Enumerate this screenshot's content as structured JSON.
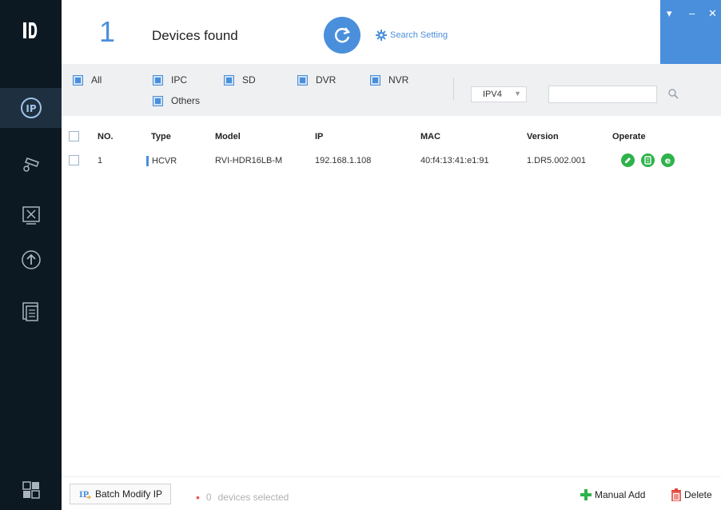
{
  "header": {
    "count": "1",
    "found_label": "Devices found",
    "search_setting": "Search Setting"
  },
  "filters": {
    "options": [
      {
        "label": "All",
        "checked": true
      },
      {
        "label": "IPC",
        "checked": true
      },
      {
        "label": "SD",
        "checked": true
      },
      {
        "label": "DVR",
        "checked": true
      },
      {
        "label": "NVR",
        "checked": true
      },
      {
        "label": "Others",
        "checked": true
      }
    ],
    "ip_version": "IPV4",
    "search_value": ""
  },
  "table": {
    "headers": {
      "no": "NO.",
      "type": "Type",
      "model": "Model",
      "ip": "IP",
      "mac": "MAC",
      "version": "Version",
      "operate": "Operate"
    },
    "rows": [
      {
        "no": "1",
        "type": "HCVR",
        "model": "RVI-HDR16LB-M",
        "ip": "192.168.1.108",
        "mac": "40:f4:13:41:e1:91",
        "version": "1.DR5.002.001"
      }
    ]
  },
  "footer": {
    "batch_label": "Batch Modify IP",
    "selected_count": "0",
    "selected_label": "devices selected",
    "manual_add": "Manual Add",
    "delete": "Delete"
  },
  "colors": {
    "accent": "#4a8fdc",
    "sidebar": "#0d1922",
    "operate_green": "#2db34a",
    "delete_red": "#e0443a"
  },
  "icons": [
    "logo-icon",
    "ip-icon",
    "camera-config-icon",
    "tools-icon",
    "upgrade-icon",
    "docs-icon",
    "apps-icon",
    "refresh-icon",
    "gear-icon",
    "search-icon",
    "edit-icon",
    "web-icon",
    "ie-icon",
    "plus-icon",
    "trash-icon"
  ]
}
